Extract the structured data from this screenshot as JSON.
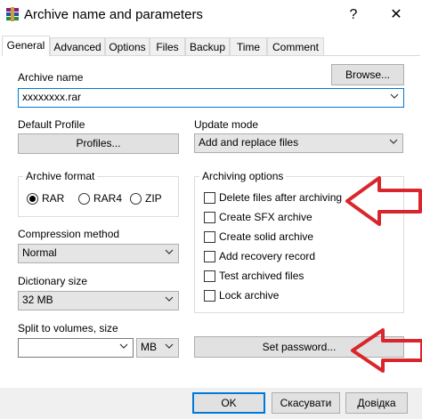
{
  "window": {
    "title": "Archive name and parameters",
    "help_label": "?",
    "close_label": "✕"
  },
  "tabs": [
    "General",
    "Advanced",
    "Options",
    "Files",
    "Backup",
    "Time",
    "Comment"
  ],
  "archive_name": {
    "label": "Archive name",
    "value": "xxxxxxxx.rar",
    "browse_label": "Browse..."
  },
  "default_profile": {
    "label": "Default Profile",
    "button_label": "Profiles..."
  },
  "update_mode": {
    "label": "Update mode",
    "value": "Add and replace files"
  },
  "archive_format": {
    "title": "Archive format",
    "options": [
      "RAR",
      "RAR4",
      "ZIP"
    ],
    "selected": "RAR"
  },
  "compression_method": {
    "label": "Compression method",
    "value": "Normal"
  },
  "dictionary_size": {
    "label": "Dictionary size",
    "value": "32 MB"
  },
  "split_volumes": {
    "label": "Split to volumes, size",
    "value": "",
    "unit": "MB"
  },
  "archiving_options": {
    "title": "Archiving options",
    "items": [
      "Delete files after archiving",
      "Create SFX archive",
      "Create solid archive",
      "Add recovery record",
      "Test archived files",
      "Lock archive"
    ]
  },
  "set_password_label": "Set password...",
  "footer": {
    "ok_label": "OK",
    "cancel_label": "Скасувати",
    "help_label": "Довідка"
  },
  "colors": {
    "annotation_arrow": "#d9262c",
    "focus_border": "#0078d7"
  }
}
